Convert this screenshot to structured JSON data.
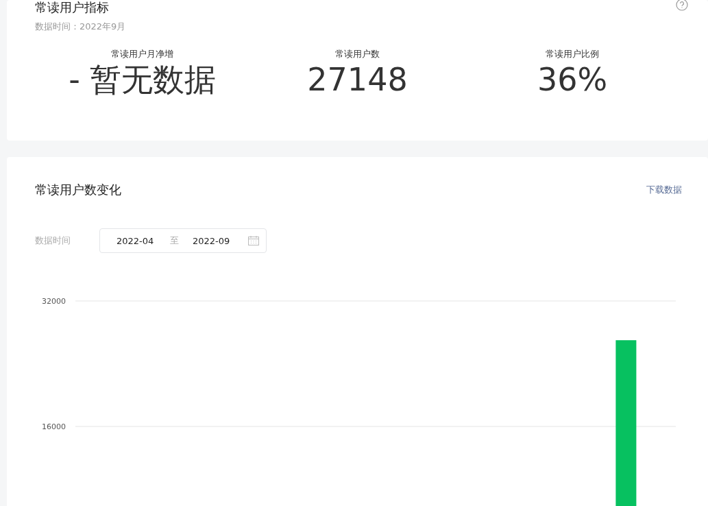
{
  "metrics_card": {
    "title": "常读用户指标",
    "data_time": "数据时间：2022年9月",
    "metrics": [
      {
        "label": "常读用户月净增",
        "value": "- 暂无数据"
      },
      {
        "label": "常读用户数",
        "value": "27148"
      },
      {
        "label": "常读用户比例",
        "value": "36%"
      }
    ]
  },
  "trend_card": {
    "title": "常读用户数变化",
    "download": "下载数据",
    "date_label": "数据时间",
    "start": "2022-04",
    "separator": "至",
    "end": "2022-09",
    "chart_data": {
      "type": "bar",
      "ylim": [
        0,
        32000
      ],
      "yticks": [
        16000,
        32000
      ],
      "series": [
        {
          "color": "#07c160",
          "values": [
            null,
            null,
            null,
            null,
            null,
            27000
          ]
        }
      ]
    }
  }
}
